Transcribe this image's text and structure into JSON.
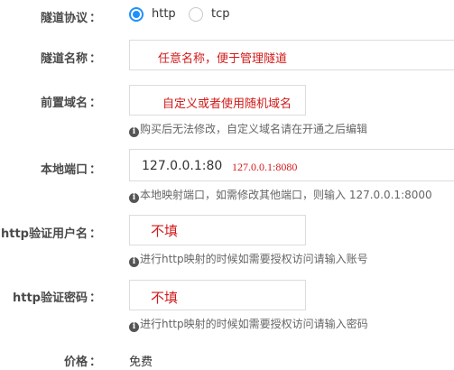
{
  "fields": {
    "protocol": {
      "label": "隧道协议",
      "colon": "：",
      "options": [
        {
          "label": "http",
          "selected": true
        },
        {
          "label": "tcp",
          "selected": false
        }
      ]
    },
    "tunnel_name": {
      "label": "隧道名称",
      "colon": "：",
      "annotation": "任意名称，便于管理隧道"
    },
    "prefix_domain": {
      "label": "前置域名",
      "colon": "：",
      "annotation": "自定义或者使用随机域名",
      "hint": "购买后无法修改，自定义域名请在开通之后编辑"
    },
    "local_port": {
      "label": "本地端口",
      "colon": "：",
      "value": "127.0.0.1:80",
      "annotation": "127.0.0.1:8080",
      "hint": "本地映射端口，如需修改其他端口，则输入 127.0.0.1:8000"
    },
    "http_username": {
      "label": "http验证用户名",
      "colon": "：",
      "annotation": "不填",
      "hint": "进行http映射的时候如需要授权访问请输入账号"
    },
    "http_password": {
      "label": "http验证密码",
      "colon": "：",
      "annotation": "不填",
      "hint": "进行http映射的时候如需要授权访问请输入密码"
    },
    "price": {
      "label": "价格",
      "colon": "：",
      "value": "免费"
    }
  },
  "icons": {
    "info": "i"
  },
  "colors": {
    "accent": "#1e90ff",
    "annotation": "#d11a1a"
  }
}
